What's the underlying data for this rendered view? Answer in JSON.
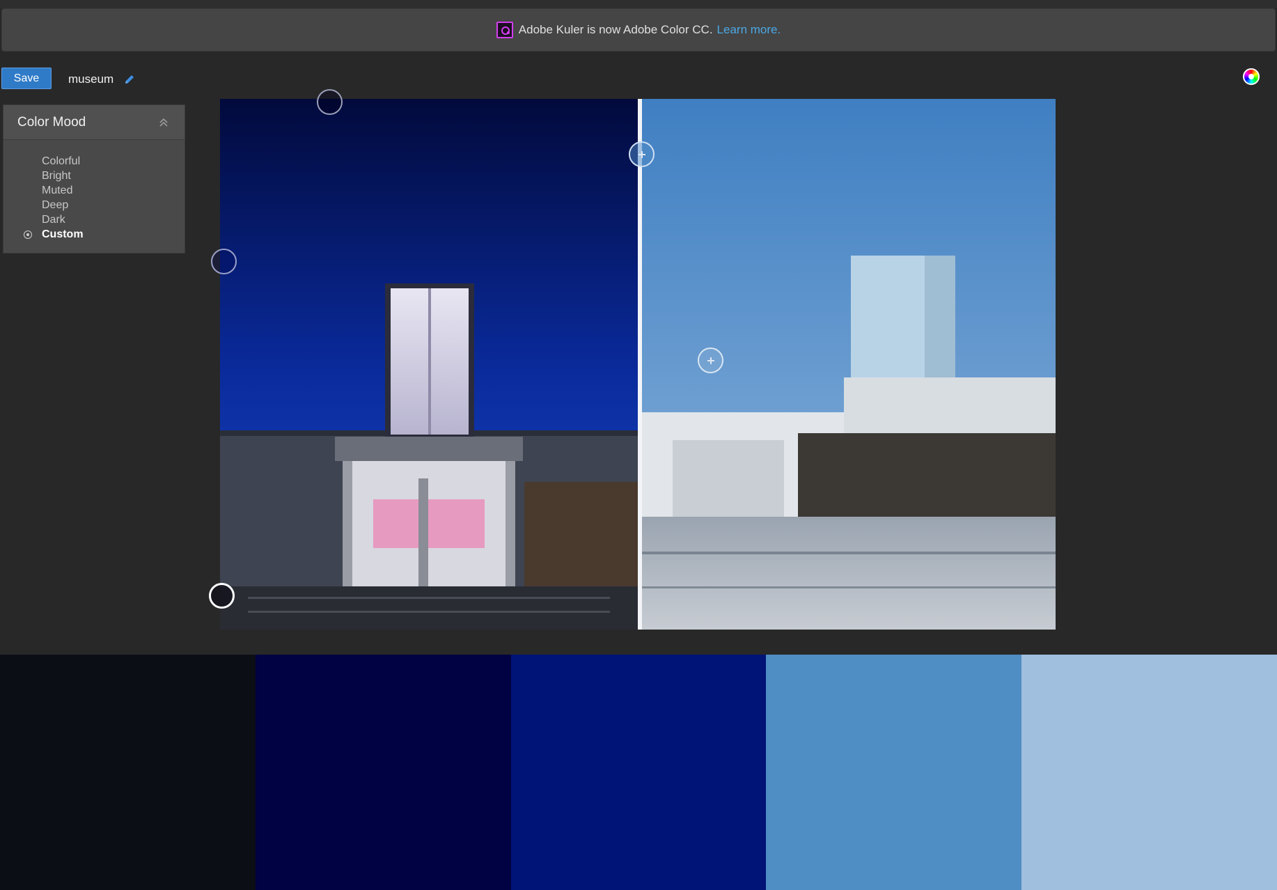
{
  "banner": {
    "message": "Adobe Kuler is now Adobe Color CC.",
    "link": "Learn more.",
    "logo_icon": "adobe-color-icon"
  },
  "toolbar": {
    "save_label": "Save",
    "theme_name": "museum",
    "edit_icon": "pencil-icon",
    "color_wheel_icon": "color-wheel-icon"
  },
  "mood": {
    "title": "Color Mood",
    "collapse_icon": "double-chevron-up-icon",
    "options": [
      {
        "label": "Colorful",
        "selected": false
      },
      {
        "label": "Bright",
        "selected": false
      },
      {
        "label": "Muted",
        "selected": false
      },
      {
        "label": "Deep",
        "selected": false
      },
      {
        "label": "Dark",
        "selected": false
      },
      {
        "label": "Custom",
        "selected": true
      }
    ]
  },
  "image": {
    "description_icon": "source-photo",
    "pickers": 5
  },
  "palette": [
    {
      "name": "swatch-1",
      "hex": "#0C0E16"
    },
    {
      "name": "swatch-2",
      "hex": "#010243"
    },
    {
      "name": "swatch-3",
      "hex": "#001376"
    },
    {
      "name": "swatch-4",
      "hex": "#4F8DC5"
    },
    {
      "name": "swatch-5",
      "hex": "#A0BFDE"
    }
  ]
}
